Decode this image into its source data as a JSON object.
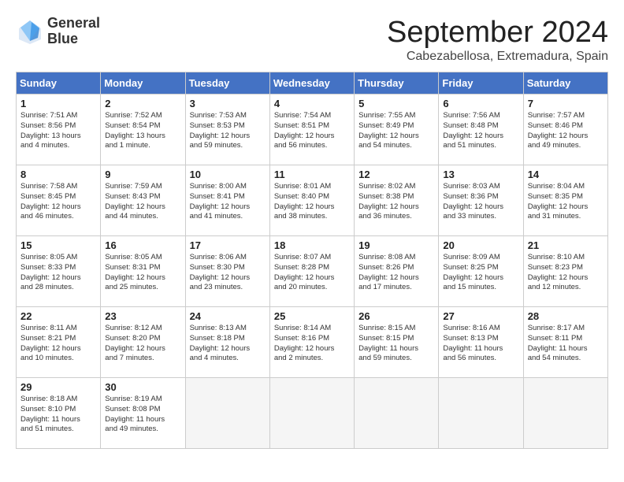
{
  "header": {
    "logo_line1": "General",
    "logo_line2": "Blue",
    "month_title": "September 2024",
    "location": "Cabezabellosa, Extremadura, Spain"
  },
  "days_of_week": [
    "Sunday",
    "Monday",
    "Tuesday",
    "Wednesday",
    "Thursday",
    "Friday",
    "Saturday"
  ],
  "weeks": [
    [
      {
        "day": 1,
        "lines": [
          "Sunrise: 7:51 AM",
          "Sunset: 8:56 PM",
          "Daylight: 13 hours",
          "and 4 minutes."
        ]
      },
      {
        "day": 2,
        "lines": [
          "Sunrise: 7:52 AM",
          "Sunset: 8:54 PM",
          "Daylight: 13 hours",
          "and 1 minute."
        ]
      },
      {
        "day": 3,
        "lines": [
          "Sunrise: 7:53 AM",
          "Sunset: 8:53 PM",
          "Daylight: 12 hours",
          "and 59 minutes."
        ]
      },
      {
        "day": 4,
        "lines": [
          "Sunrise: 7:54 AM",
          "Sunset: 8:51 PM",
          "Daylight: 12 hours",
          "and 56 minutes."
        ]
      },
      {
        "day": 5,
        "lines": [
          "Sunrise: 7:55 AM",
          "Sunset: 8:49 PM",
          "Daylight: 12 hours",
          "and 54 minutes."
        ]
      },
      {
        "day": 6,
        "lines": [
          "Sunrise: 7:56 AM",
          "Sunset: 8:48 PM",
          "Daylight: 12 hours",
          "and 51 minutes."
        ]
      },
      {
        "day": 7,
        "lines": [
          "Sunrise: 7:57 AM",
          "Sunset: 8:46 PM",
          "Daylight: 12 hours",
          "and 49 minutes."
        ]
      }
    ],
    [
      {
        "day": 8,
        "lines": [
          "Sunrise: 7:58 AM",
          "Sunset: 8:45 PM",
          "Daylight: 12 hours",
          "and 46 minutes."
        ]
      },
      {
        "day": 9,
        "lines": [
          "Sunrise: 7:59 AM",
          "Sunset: 8:43 PM",
          "Daylight: 12 hours",
          "and 44 minutes."
        ]
      },
      {
        "day": 10,
        "lines": [
          "Sunrise: 8:00 AM",
          "Sunset: 8:41 PM",
          "Daylight: 12 hours",
          "and 41 minutes."
        ]
      },
      {
        "day": 11,
        "lines": [
          "Sunrise: 8:01 AM",
          "Sunset: 8:40 PM",
          "Daylight: 12 hours",
          "and 38 minutes."
        ]
      },
      {
        "day": 12,
        "lines": [
          "Sunrise: 8:02 AM",
          "Sunset: 8:38 PM",
          "Daylight: 12 hours",
          "and 36 minutes."
        ]
      },
      {
        "day": 13,
        "lines": [
          "Sunrise: 8:03 AM",
          "Sunset: 8:36 PM",
          "Daylight: 12 hours",
          "and 33 minutes."
        ]
      },
      {
        "day": 14,
        "lines": [
          "Sunrise: 8:04 AM",
          "Sunset: 8:35 PM",
          "Daylight: 12 hours",
          "and 31 minutes."
        ]
      }
    ],
    [
      {
        "day": 15,
        "lines": [
          "Sunrise: 8:05 AM",
          "Sunset: 8:33 PM",
          "Daylight: 12 hours",
          "and 28 minutes."
        ]
      },
      {
        "day": 16,
        "lines": [
          "Sunrise: 8:05 AM",
          "Sunset: 8:31 PM",
          "Daylight: 12 hours",
          "and 25 minutes."
        ]
      },
      {
        "day": 17,
        "lines": [
          "Sunrise: 8:06 AM",
          "Sunset: 8:30 PM",
          "Daylight: 12 hours",
          "and 23 minutes."
        ]
      },
      {
        "day": 18,
        "lines": [
          "Sunrise: 8:07 AM",
          "Sunset: 8:28 PM",
          "Daylight: 12 hours",
          "and 20 minutes."
        ]
      },
      {
        "day": 19,
        "lines": [
          "Sunrise: 8:08 AM",
          "Sunset: 8:26 PM",
          "Daylight: 12 hours",
          "and 17 minutes."
        ]
      },
      {
        "day": 20,
        "lines": [
          "Sunrise: 8:09 AM",
          "Sunset: 8:25 PM",
          "Daylight: 12 hours",
          "and 15 minutes."
        ]
      },
      {
        "day": 21,
        "lines": [
          "Sunrise: 8:10 AM",
          "Sunset: 8:23 PM",
          "Daylight: 12 hours",
          "and 12 minutes."
        ]
      }
    ],
    [
      {
        "day": 22,
        "lines": [
          "Sunrise: 8:11 AM",
          "Sunset: 8:21 PM",
          "Daylight: 12 hours",
          "and 10 minutes."
        ]
      },
      {
        "day": 23,
        "lines": [
          "Sunrise: 8:12 AM",
          "Sunset: 8:20 PM",
          "Daylight: 12 hours",
          "and 7 minutes."
        ]
      },
      {
        "day": 24,
        "lines": [
          "Sunrise: 8:13 AM",
          "Sunset: 8:18 PM",
          "Daylight: 12 hours",
          "and 4 minutes."
        ]
      },
      {
        "day": 25,
        "lines": [
          "Sunrise: 8:14 AM",
          "Sunset: 8:16 PM",
          "Daylight: 12 hours",
          "and 2 minutes."
        ]
      },
      {
        "day": 26,
        "lines": [
          "Sunrise: 8:15 AM",
          "Sunset: 8:15 PM",
          "Daylight: 11 hours",
          "and 59 minutes."
        ]
      },
      {
        "day": 27,
        "lines": [
          "Sunrise: 8:16 AM",
          "Sunset: 8:13 PM",
          "Daylight: 11 hours",
          "and 56 minutes."
        ]
      },
      {
        "day": 28,
        "lines": [
          "Sunrise: 8:17 AM",
          "Sunset: 8:11 PM",
          "Daylight: 11 hours",
          "and 54 minutes."
        ]
      }
    ],
    [
      {
        "day": 29,
        "lines": [
          "Sunrise: 8:18 AM",
          "Sunset: 8:10 PM",
          "Daylight: 11 hours",
          "and 51 minutes."
        ]
      },
      {
        "day": 30,
        "lines": [
          "Sunrise: 8:19 AM",
          "Sunset: 8:08 PM",
          "Daylight: 11 hours",
          "and 49 minutes."
        ]
      },
      {
        "day": null,
        "lines": []
      },
      {
        "day": null,
        "lines": []
      },
      {
        "day": null,
        "lines": []
      },
      {
        "day": null,
        "lines": []
      },
      {
        "day": null,
        "lines": []
      }
    ]
  ]
}
